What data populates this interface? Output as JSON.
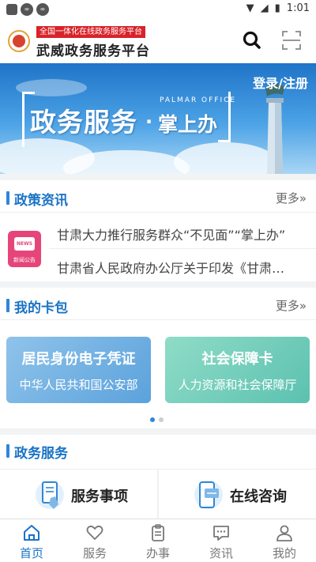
{
  "status_bar": {
    "time": "1:01"
  },
  "header": {
    "tagline": "全国一体化在线政务服务平台",
    "title": "武威政务服务平台"
  },
  "banner": {
    "title": "政务服务",
    "subtitle": "掌上办",
    "english": "PALMAR OFFICE",
    "login_label": "登录/注册"
  },
  "policy_news": {
    "title": "政策资讯",
    "more_label": "更多»",
    "icon_caption": "新闻公告",
    "icon_text": "NEWS",
    "items": [
      "甘肃大力推行服务群众“不见面”“掌上办”",
      "甘肃省人民政府办公厅关于印发《甘肃…"
    ]
  },
  "card_wallet": {
    "title": "我的卡包",
    "more_label": "更多»",
    "cards": [
      {
        "title": "居民身份电子凭证",
        "subtitle": "中华人民共和国公安部",
        "color": "#6aaee2"
      },
      {
        "title": "社会保障卡",
        "subtitle": "人力资源和社会保障厅",
        "color": "#6ccbb8"
      }
    ],
    "page_count": 2,
    "active_page": 1
  },
  "gov_services": {
    "title": "政务服务",
    "items": [
      {
        "label": "服务事项",
        "icon": "document-hand-icon"
      },
      {
        "label": "在线咨询",
        "icon": "phone-chat-icon"
      }
    ]
  },
  "tabbar": {
    "tabs": [
      {
        "label": "首页",
        "icon": "home-icon",
        "active": true
      },
      {
        "label": "服务",
        "icon": "heart-hands-icon",
        "active": false
      },
      {
        "label": "办事",
        "icon": "clipboard-icon",
        "active": false
      },
      {
        "label": "资讯",
        "icon": "chat-bubble-icon",
        "active": false
      },
      {
        "label": "我的",
        "icon": "user-icon",
        "active": false
      }
    ]
  },
  "colors": {
    "accent": "#1a73c6",
    "tagline_red": "#d8232a",
    "news_pink": "#e6457a"
  }
}
